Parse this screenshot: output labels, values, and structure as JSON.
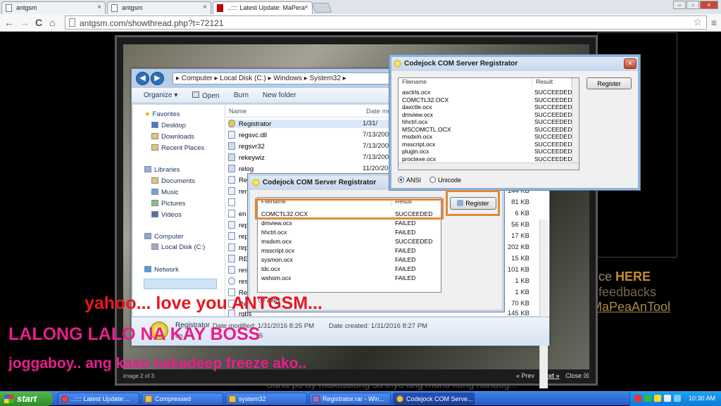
{
  "browser": {
    "tabs": [
      {
        "label": "antgsm",
        "close": "×"
      },
      {
        "label": "antgsm",
        "close": "×"
      },
      {
        "label": "..:::: Latest Update: MaPera",
        "close": "×"
      }
    ],
    "window_buttons": [
      "–",
      "▫",
      "×"
    ],
    "url": "antgsm.com/showthread.php?t=72121",
    "nav": {
      "back": "←",
      "forward": "→",
      "reload": "C",
      "home": "⌂"
    },
    "star": "☆",
    "menu": "≡"
  },
  "background_page": {
    "line1_prefix": "ce",
    "line1_link": "HERE",
    "line2": "feedbacks",
    "line3": "MaPeaAnTool",
    "bottom_text": "Sana po ay makatulong sa inyo ang munti kong handog...",
    "image_counter": "image 2 of 3",
    "prev": "« Prev",
    "next": "Next »",
    "close": "Close ☒"
  },
  "explorer": {
    "breadcrumb": "▸  Computer  ▸  Local Disk (C:)  ▸  Windows  ▸  System32  ▸",
    "commands": {
      "organize": "Organize ▾",
      "open": "Open",
      "burn": "Burn",
      "new_folder": "New folder"
    },
    "nav_pane": {
      "favorites": "Favorites",
      "desktop": "Desktop",
      "downloads": "Downloads",
      "recent": "Recent Places",
      "libraries": "Libraries",
      "documents": "Documents",
      "music": "Music",
      "pictures": "Pictures",
      "videos": "Videos",
      "computer": "Computer",
      "local_disk": "Local Disk (C:)",
      "network": "Network"
    },
    "columns": {
      "name": "Name",
      "date": "Date mo"
    },
    "files": [
      {
        "name": "Registrator",
        "date": "1/31/"
      },
      {
        "name": "regsvc.dll",
        "date": "7/13/200"
      },
      {
        "name": "regsvr32",
        "date": "7/13/200"
      },
      {
        "name": "rekeywiz",
        "date": "7/13/200"
      },
      {
        "name": "relog",
        "date": "11/20/20"
      },
      {
        "name": "Rel",
        "date": ""
      },
      {
        "name": "ren",
        "date": ""
      },
      {
        "name": "",
        "date": ""
      },
      {
        "name": "en",
        "date": ""
      },
      {
        "name": "rep",
        "date": ""
      },
      {
        "name": "rep",
        "date": ""
      },
      {
        "name": "rep",
        "date": ""
      },
      {
        "name": "RES",
        "date": ""
      },
      {
        "name": "res",
        "date": ""
      },
      {
        "name": "res",
        "date": ""
      },
      {
        "name": "Res",
        "date": ""
      },
      {
        "name": "Res",
        "date": ""
      },
      {
        "name": "rgbs",
        "date": ""
      }
    ],
    "sizes": [
      "144 KB",
      "81 KB",
      "6 KB",
      "56 KB",
      "17 KB",
      "202 KB",
      "15 KB",
      "101 KB",
      "1 KB",
      "1 KB",
      "70 KB",
      "145 KB"
    ],
    "details": {
      "name": "Registrator",
      "modified": "Date modified: 1/31/2016 8:25 PM",
      "created": "Date created: 1/31/2016 8:27 PM",
      "type_prefix": "on",
      "size_prefix": "55"
    }
  },
  "dialog_small": {
    "title": "Codejock COM Server Registrator",
    "columns": {
      "filename": "Filename",
      "result": "Result"
    },
    "rows": [
      {
        "file": "COMCTL32.OCX",
        "result": "SUCCEEDED"
      },
      {
        "file": "dmview.ocx",
        "result": "FAILED"
      },
      {
        "file": "hhctrl.ocx",
        "result": "FAILED"
      },
      {
        "file": "msdxm.ocx",
        "result": "SUCCEEDED"
      },
      {
        "file": "msscript.ocx",
        "result": "FAILED"
      },
      {
        "file": "sysmon.ocx",
        "result": "FAILED"
      },
      {
        "file": "tdc.ocx",
        "result": "FAILED"
      },
      {
        "file": "wshom.ocx",
        "result": "FAILED"
      }
    ],
    "register": "Register",
    "ansi_partial": "ANS"
  },
  "dialog_large": {
    "title": "Codejock COM Server Registrator",
    "close": "×",
    "columns": {
      "filename": "Filename",
      "result": "Result"
    },
    "rows": [
      {
        "file": "asctrls.ocx",
        "result": "SUCCEEDED"
      },
      {
        "file": "COMCTL32.OCX",
        "result": "SUCCEEDED"
      },
      {
        "file": "daxctle.ocx",
        "result": "SUCCEEDED"
      },
      {
        "file": "dmview.ocx",
        "result": "SUCCEEDED"
      },
      {
        "file": "hhctrl.ocx",
        "result": "SUCCEEDED"
      },
      {
        "file": "MSCOMCTL.OCX",
        "result": "SUCCEEDED"
      },
      {
        "file": "msdxm.ocx",
        "result": "SUCCEEDED"
      },
      {
        "file": "msscript.ocx",
        "result": "SUCCEEDED"
      },
      {
        "file": "plugin.ocx",
        "result": "SUCCEEDED"
      },
      {
        "file": "proctexe.ocx",
        "result": "SUCCEEDED"
      }
    ],
    "register": "Register",
    "ansi": "ANSI",
    "unicode": "Unicode"
  },
  "overlay_text": {
    "line1": "yahoo... love you ANTGSM...",
    "line2": "LALONG LALO NA KAY BOSS",
    "line3": "joggaboy.. ang kaso nakadeep freeze ako.."
  },
  "taskbar": {
    "start": "start",
    "items": [
      {
        "label": "..:::: Latest Update:..."
      },
      {
        "label": "Compressed"
      },
      {
        "label": "system32"
      },
      {
        "label": "Registrator.rar - Win..."
      },
      {
        "label": "Codejock COM Serve..."
      }
    ],
    "clock": "10:30 AM"
  },
  "colors": {
    "highlight": "#e0893a",
    "overlay_red": "#e8161f",
    "overlay_magenta": "#e81e8c",
    "taskbar_blue": "#2459c8",
    "start_green": "#2e8a2a"
  }
}
